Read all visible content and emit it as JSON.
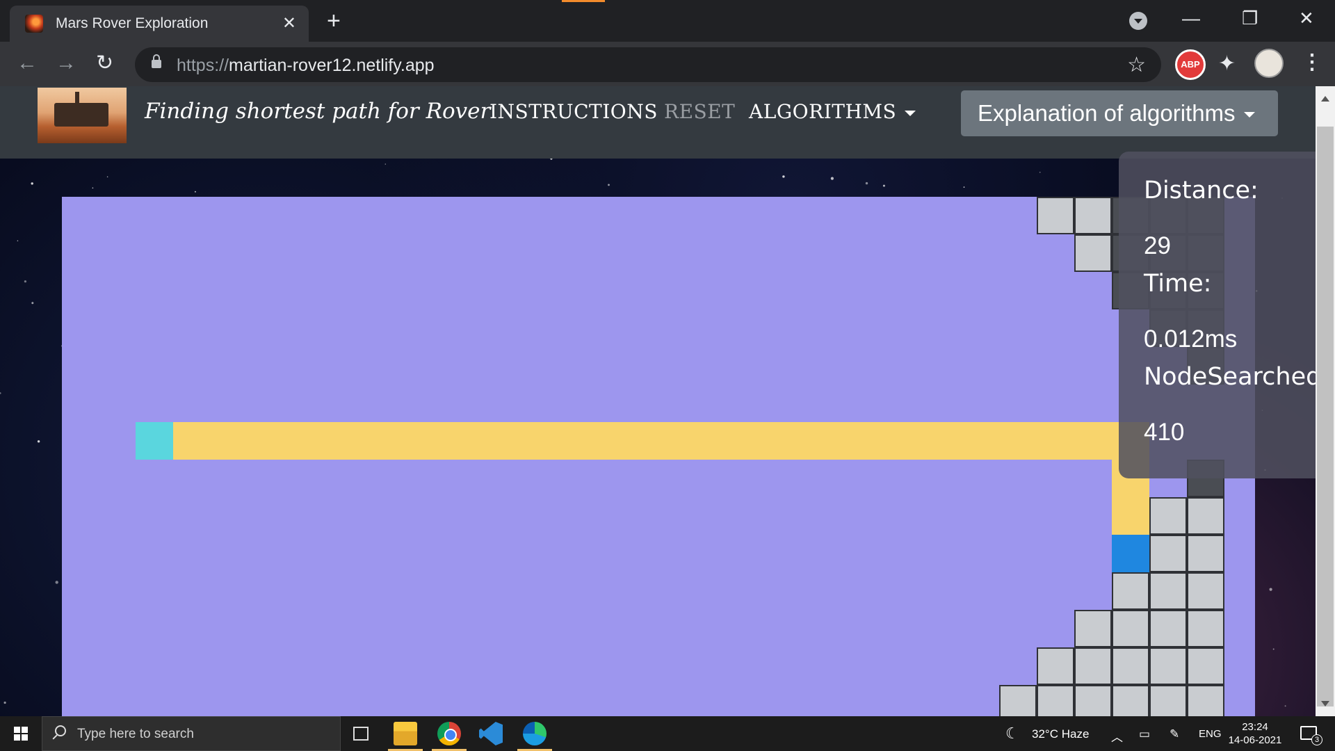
{
  "browser": {
    "tab_title": "Mars Rover Exploration",
    "tab_close": "✕",
    "new_tab": "+",
    "url_scheme": "https://",
    "url_host": "martian-rover12.netlify.app",
    "abp_label": "ABP",
    "minimize": "—",
    "restore": "❐",
    "close": "✕"
  },
  "app": {
    "brand": "Finding shortest path for Rover",
    "nav": {
      "instructions": "INSTRUCTIONS",
      "reset": "RESET",
      "algorithms": "ALGORITHMS",
      "explanation": "Explanation of algorithms"
    },
    "stats": {
      "distance_label": "Distance:",
      "distance_value": "29",
      "time_label": "Time:",
      "time_value": "0.012ms",
      "nodes_label": "NodeSearched",
      "nodes_value": "410"
    }
  },
  "grid": {
    "columns": 39,
    "rows": 14,
    "start": {
      "col": 3,
      "row": 6
    },
    "target": {
      "col": 29,
      "row": 9
    },
    "path_row_cols": [
      4,
      28
    ],
    "path_down": [
      {
        "col": 29,
        "row": 6
      },
      {
        "col": 29,
        "row": 7
      },
      {
        "col": 29,
        "row": 8
      }
    ],
    "visited": [
      [
        27,
        0
      ],
      [
        28,
        0
      ],
      [
        28,
        1
      ],
      [
        30,
        8
      ],
      [
        31,
        8
      ],
      [
        30,
        9
      ],
      [
        31,
        9
      ],
      [
        29,
        10
      ],
      [
        30,
        10
      ],
      [
        31,
        10
      ],
      [
        28,
        11
      ],
      [
        29,
        11
      ],
      [
        30,
        11
      ],
      [
        31,
        11
      ],
      [
        27,
        12
      ],
      [
        28,
        12
      ],
      [
        29,
        12
      ],
      [
        30,
        12
      ],
      [
        31,
        12
      ],
      [
        26,
        13
      ],
      [
        27,
        13
      ],
      [
        28,
        13
      ],
      [
        29,
        13
      ],
      [
        30,
        13
      ],
      [
        31,
        13
      ]
    ],
    "walls": [
      [
        29,
        0
      ],
      [
        30,
        0
      ],
      [
        31,
        0
      ],
      [
        29,
        1
      ],
      [
        30,
        1
      ],
      [
        31,
        1
      ],
      [
        29,
        2
      ],
      [
        30,
        2
      ],
      [
        31,
        2
      ],
      [
        30,
        3
      ],
      [
        31,
        3
      ],
      [
        31,
        4
      ],
      [
        31,
        7
      ]
    ],
    "colors": {
      "background": "#9d96ee",
      "visited": "#c9ccd0",
      "path": "#f8d46c",
      "start": "#5ad6de",
      "target": "#1f87e0"
    }
  },
  "taskbar": {
    "search_placeholder": "Type here to search",
    "weather": "32°C  Haze",
    "language": "ENG",
    "time": "23:24",
    "date": "14-06-2021",
    "notifications": "3"
  }
}
